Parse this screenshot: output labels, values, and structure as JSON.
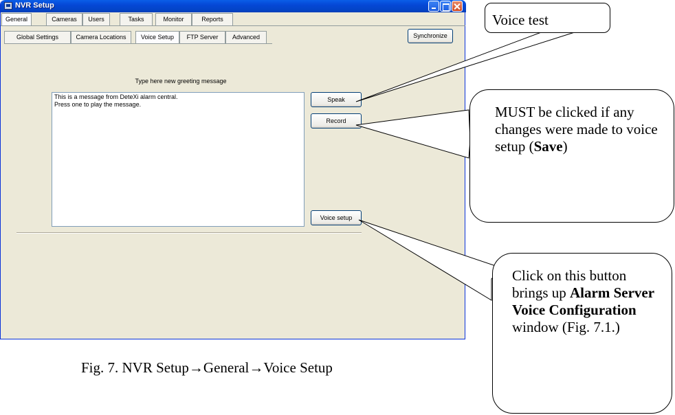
{
  "window": {
    "title": "NVR Setup",
    "main_tabs": [
      "General",
      "Cameras",
      "Users",
      "Tasks",
      "Monitor",
      "Reports"
    ],
    "synchronize_label": "Synchronize",
    "sub_tabs": [
      "Global Settings",
      "Camera Locations",
      "Voice Setup",
      "FTP Server",
      "Advanced"
    ],
    "active_main_tab": "General",
    "active_sub_tab": "Voice Setup",
    "prompt_label": "Type here new greeting message",
    "message_lines": [
      "This is a message from DeteXi alarm central.",
      "Press one to play the message."
    ],
    "speak_label": "Speak",
    "record_label": "Record",
    "voice_setup_label": "Voice setup"
  },
  "callouts": {
    "voice_test": "Voice test",
    "save_note_prefix": "MUST be clicked if any changes were made to voice setup (",
    "save_note_bold": "Save",
    "save_note_suffix": ")",
    "voice_setup_prefix": "Click on this button brings up ",
    "voice_setup_bold": "Alarm Server Voice Configuration",
    "voice_setup_suffix": " window (Fig. 7.1.)"
  },
  "caption": "Fig. 7. NVR Setup→General→Voice Setup",
  "colors": {
    "titlebar": "#0548d6",
    "window_face": "#ece9d8",
    "button_border": "#003c74"
  }
}
